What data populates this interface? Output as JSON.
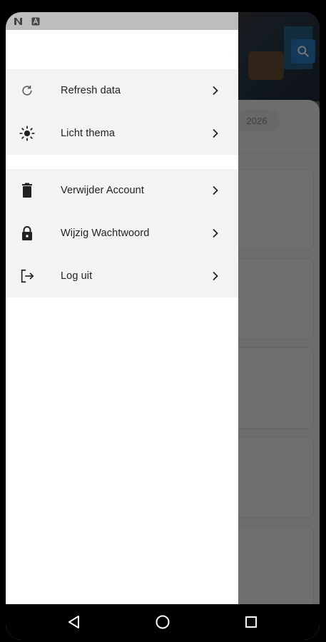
{
  "status_bar": {
    "icons": [
      "n-app-icon",
      "a-app-icon"
    ]
  },
  "background": {
    "year_chip": "2026",
    "search_icon": "search-icon"
  },
  "drawer": {
    "groups": [
      [
        {
          "label": "Refresh data",
          "icon": "refresh-icon"
        },
        {
          "label": "Licht thema",
          "icon": "sun-icon"
        }
      ],
      [
        {
          "label": "Verwijder Account",
          "icon": "trash-icon"
        },
        {
          "label": "Wijzig Wachtwoord",
          "icon": "lock-icon"
        },
        {
          "label": "Log uit",
          "icon": "logout-icon"
        }
      ]
    ]
  },
  "nav_bar": {
    "buttons": [
      "back-icon",
      "home-icon",
      "recents-icon"
    ]
  }
}
